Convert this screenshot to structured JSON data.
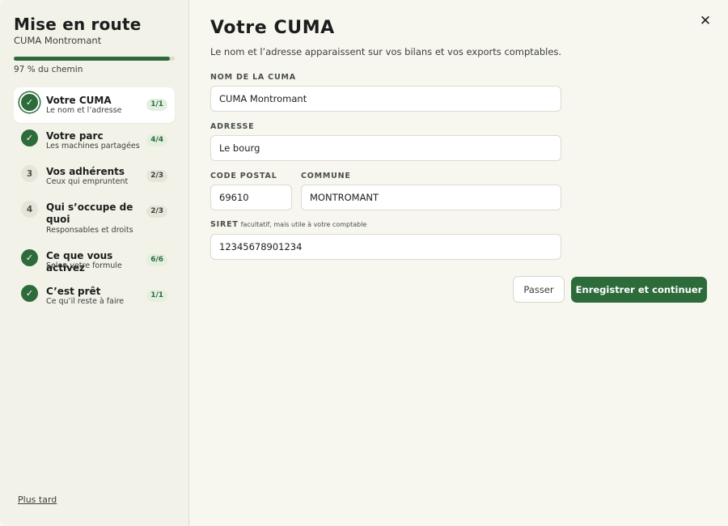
{
  "sidebar": {
    "title": "Mise en route",
    "subtitle": "CUMA Montromant",
    "progress": {
      "percent": 97,
      "label": "97 % du chemin"
    },
    "later_link": "Plus tard",
    "steps": [
      {
        "icon": "check-icon",
        "number": "",
        "title": "Votre CUMA",
        "desc": "Le nom et l’adresse",
        "badge": "1/1",
        "state": "current"
      },
      {
        "icon": "check-icon",
        "number": "",
        "title": "Votre parc",
        "desc": "Les machines partagées",
        "badge": "4/4",
        "state": "done"
      },
      {
        "icon": "",
        "number": "3",
        "title": "Vos adhérents",
        "desc": "Ceux qui empruntent",
        "badge": "2/3",
        "state": "todo"
      },
      {
        "icon": "",
        "number": "4",
        "title": "Qui s’occupe de quoi",
        "desc": "Responsables et droits",
        "badge": "2/3",
        "state": "todo"
      },
      {
        "icon": "check-icon",
        "number": "",
        "title": "Ce que vous activez",
        "desc": "Selon votre formule",
        "badge": "6/6",
        "state": "done"
      },
      {
        "icon": "check-icon",
        "number": "",
        "title": "C’est prêt",
        "desc": "Ce qu’il reste à faire",
        "badge": "1/1",
        "state": "done"
      }
    ]
  },
  "main": {
    "title": "Votre CUMA",
    "description": "Le nom et l’adresse apparaissent sur vos bilans et vos exports comptables.",
    "close_icon": "close-icon",
    "fields": {
      "name": {
        "label": "NOM DE LA CUMA",
        "value": "CUMA Montromant"
      },
      "address": {
        "label": "ADRESSE",
        "value": "Le bourg"
      },
      "postal_code": {
        "label": "CODE POSTAL",
        "value": "69610"
      },
      "city": {
        "label": "COMMUNE",
        "value": "MONTROMANT"
      },
      "siret": {
        "label": "SIRET",
        "hint": "facultatif, mais utile à votre comptable",
        "value": "12345678901234"
      }
    },
    "buttons": {
      "skip": "Passer",
      "save": "Enregistrer et continuer"
    }
  },
  "colors": {
    "accent": "#2e6b3b",
    "background": "#f7f6ef",
    "sidebar": "#f3f2e8"
  }
}
